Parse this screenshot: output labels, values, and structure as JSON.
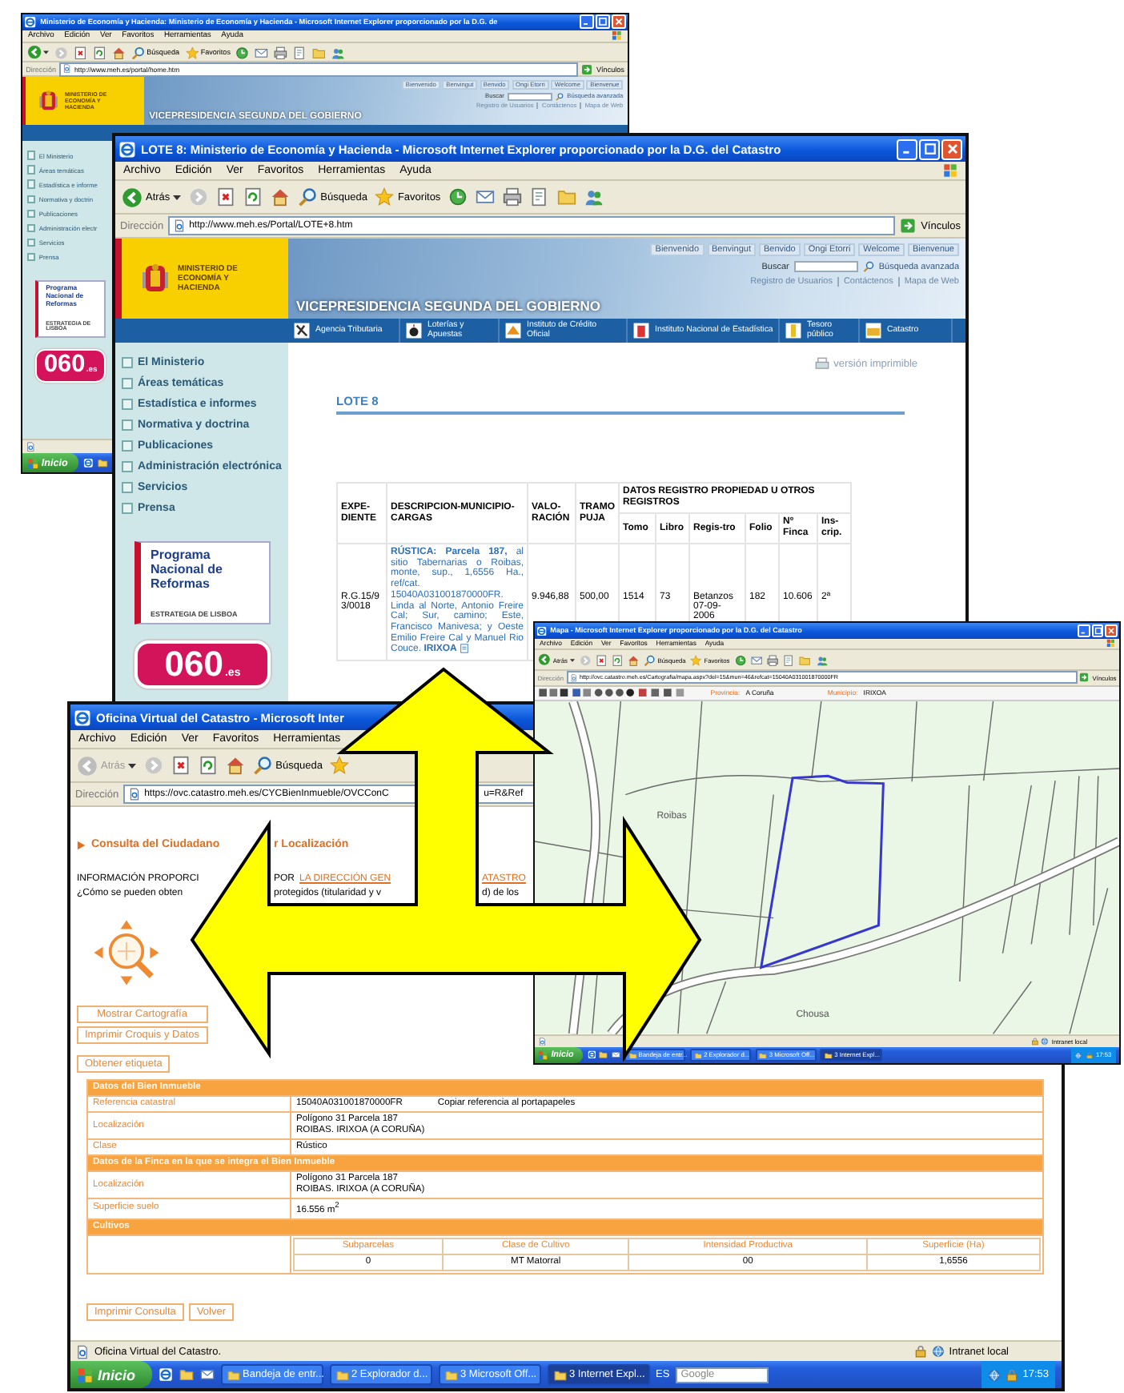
{
  "windows": [
    {
      "kind": "ministry",
      "title": "Ministerio de Economía y Hacienda: Ministerio de Economía y Hacienda - Microsoft Internet Explorer proporcionado por la D.G. de",
      "menu": [
        "Archivo",
        "Edición",
        "Ver",
        "Favoritos",
        "Herramientas",
        "Ayuda"
      ],
      "toolbar": {
        "back_disabled": false,
        "search": "Búsqueda",
        "favorites": "Favoritos"
      },
      "address_label": "Dirección",
      "address": [
        "http://www.meh.es/portal/home.htm"
      ],
      "links_label": "Vínculos",
      "page": {
        "ministry": "MINISTERIO DE ECONOMÍA Y HACIENDA",
        "languages": [
          "Bienvenido",
          "Benvingut",
          "Benvido",
          "Ongi Etorri",
          "Welcome",
          "Bienvenue"
        ],
        "search_label": "Buscar",
        "advanced_search": "Búsqueda avanzada",
        "user_links": [
          "Registro de Usuarios",
          "Contáctenos",
          "Mapa de Web"
        ],
        "banner": "VICEPRESIDENCIA SEGUNDA DEL GOBIERNO",
        "nav": [
          "El Ministerio",
          "Áreas temáticas",
          "Estadística e informe",
          "Normativa y doctrin",
          "Publicaciones",
          "Administración electr",
          "Servicios",
          "Prensa"
        ],
        "reform_logo": {
          "title": "Programa Nacional de Reformas",
          "subtitle": "ESTRATEGIA DE LISBOA"
        },
        "phone_logo": {
          "number": "060",
          "suffix": ".es"
        }
      },
      "taskbar": {
        "start": "Inicio"
      }
    },
    {
      "kind": "ministry",
      "title": "LOTE 8: Ministerio de Economía y Hacienda - Microsoft Internet Explorer proporcionado por la D.G. del Catastro",
      "menu": [
        "Archivo",
        "Edición",
        "Ver",
        "Favoritos",
        "Herramientas",
        "Ayuda"
      ],
      "toolbar": {
        "back": "Atrás",
        "back_disabled": false,
        "search": "Búsqueda",
        "favorites": "Favoritos"
      },
      "address_label": "Dirección",
      "address": [
        "http://www.meh.es/Portal/LOTE+8.htm"
      ],
      "links_label": "Vínculos",
      "page": {
        "ministry": "MINISTERIO DE ECONOMÍA Y HACIENDA",
        "languages": [
          "Bienvenido",
          "Benvingut",
          "Benvido",
          "Ongi Etorri",
          "Welcome",
          "Bienvenue"
        ],
        "search_label": "Buscar",
        "advanced_search": "Búsqueda avanzada",
        "user_links": [
          "Registro de Usuarios",
          "Contáctenos",
          "Mapa de Web"
        ],
        "banner": "VICEPRESIDENCIA SEGUNDA DEL GOBIERNO",
        "services": [
          "Agencia Tributaria",
          "Loterías y Apuestas",
          "Instituto de Crédito Oficial",
          "Instituto Nacional de Estadística",
          "Tesoro público",
          "Catastro"
        ],
        "nav": [
          "El Ministerio",
          "Áreas temáticas",
          "Estadística e informes",
          "Normativa y doctrina",
          "Publicaciones",
          "Administración electrónica",
          "Servicios",
          "Prensa"
        ],
        "reform_logo": {
          "title": "Programa Nacional de Reformas",
          "subtitle": "ESTRATEGIA DE LISBOA"
        },
        "phone_logo": {
          "number": "060",
          "suffix": ".es"
        },
        "print_link": "versión imprimible",
        "lot_title": "LOTE 8",
        "table": {
          "columns": [
            "EXPE-DIENTE",
            "DESCRIPCION-MUNICIPIO-CARGAS",
            "VALO-RACIÓN",
            "TRAMO PUJA"
          ],
          "column_groups": [
            {
              "label": "DATOS REGISTRO PROPIEDAD U OTROS REGISTROS",
              "columns": [
                "Tomo",
                "Libro",
                "Regis-tro",
                "Folio",
                "Nº Finca",
                "Ins-crip."
              ]
            }
          ],
          "rows": [
            [
              "R.G.15/93/0018",
              "**RÚSTICA: Parcela 187,** al sitio Tabernarias o Roibas, monte, sup., 1,6556 Ha., ref/cat. 15040A031001870000FR. Linda al Norte, Antonio Freire Cal; Sur, camino; Este, Francisco Manivesa; y Oeste Emilio Freire Cal y Manuel Rio Couce. **IRIXOA**",
              "9.946,88",
              "500,00",
              "1514",
              "73",
              "Betanzos 07-09-2006",
              "182",
              "10.606",
              "2ª"
            ]
          ]
        }
      }
    },
    {
      "kind": "catastro",
      "title": "Oficina Virtual del Catastro - Microsoft Inter",
      "menu": [
        "Archivo",
        "Edición",
        "Ver",
        "Favoritos",
        "Herramientas"
      ],
      "toolbar": {
        "back": "Atrás",
        "back_disabled": true,
        "search": "Búsqueda"
      },
      "address_label": "Dirección",
      "address": [
        "https://ovc.catastro.meh.es/CYCBienInmueble/OVCConC",
        "u=R&Ref"
      ],
      "page": {
        "heading": [
          "Consulta del Ciudadano",
          "r Localización"
        ],
        "notice": [
          {
            "kind": "text",
            "text": "INFORMACIÓN PROPORCI"
          },
          {
            "kind": "text",
            "text": "POR"
          },
          {
            "kind": "link",
            "text": "LA DIRECCIÓN GEN"
          },
          {
            "kind": "link",
            "text": "ATASTRO"
          }
        ],
        "question": [
          "¿Cómo se pueden obten",
          "protegidos (titularidad y v",
          "d) de los"
        ],
        "buttons": [
          "Mostrar Cartografía",
          "Imprimir Croquis y Datos"
        ],
        "label_button": "Obtener etiqueta",
        "sections": [
          {
            "title": "Datos del Bien Inmueble",
            "rows": [
              {
                "label": "Referencia catastral",
                "value": [
                  "15040A031001870000FR"
                ],
                "action": "Copiar referencia al portapapeles"
              },
              {
                "label": "Localización",
                "value": [
                  "Polígono 31 Parcela 187",
                  "ROIBAS. IRIXOA (A CORUÑA)"
                ]
              },
              {
                "label": "Clase",
                "value": [
                  "Rústico"
                ]
              }
            ]
          },
          {
            "title": "Datos de la Finca en la que se integra el Bien Inmueble",
            "rows": [
              {
                "label": "Localización",
                "value": [
                  "Polígono 31 Parcela 187",
                  "ROIBAS. IRIXOA (A CORUÑA)"
                ]
              },
              {
                "label": "Superficie suelo",
                "value": [
                  "16.556 m$^{2}$"
                ]
              }
            ]
          },
          {
            "title": "Cultivos",
            "crops": {
              "columns": [
                "Subparcelas",
                "Clase de Cultivo",
                "Intensidad Productiva",
                "Superficie (Ha)"
              ],
              "rows": [
                [
                  "0",
                  "MT Matorral",
                  "00",
                  "1,6556"
                ]
              ]
            }
          }
        ],
        "footer_buttons": [
          "Imprimir Consulta",
          "Volver"
        ]
      },
      "status": {
        "text": "Oficina Virtual del Catastro.",
        "zone": "Intranet local"
      },
      "taskbar": {
        "start": "Inicio",
        "tasks": [
          {
            "label": "Bandeja de entr...",
            "selected": false
          },
          {
            "label": "2 Explorador d...",
            "selected": false
          },
          {
            "label": "3 Microsoft Off...",
            "selected": false
          },
          {
            "label": "3 Internet Expl...",
            "selected": true
          }
        ],
        "language": "ES",
        "search_placeholder": "Google",
        "clock": "17:53"
      }
    },
    {
      "kind": "map",
      "title": "Mapa - Microsoft Internet Explorer proporcionado por la D.G. del Catastro",
      "menu": [
        "Archivo",
        "Edición",
        "Ver",
        "Favoritos",
        "Herramientas",
        "Ayuda"
      ],
      "toolbar": {
        "back": "Atrás",
        "back_disabled": false,
        "search": "Búsqueda",
        "favorites": "Favoritos"
      },
      "address_label": "Dirección",
      "address": [
        "http://ovc.catastro.meh.es/Cartografia/mapa.aspx?del=15&mun=46&refcat=15040A031001870000FR"
      ],
      "links_label": "Vínculos",
      "page": {
        "province_label": "Provincia:",
        "province": "A Coruña",
        "municipality_label": "Municipio:",
        "municipality": "IRIXOA",
        "places": [
          "Roibas",
          "Chousa"
        ]
      },
      "status": {
        "zone": "Intranet local"
      },
      "taskbar": {
        "start": "Inicio",
        "tasks": [
          {
            "label": "Bandeja de entr...",
            "selected": false
          },
          {
            "label": "2 Explorador d...",
            "selected": false
          },
          {
            "label": "3 Microsoft Off...",
            "selected": false
          },
          {
            "label": "3 Internet Expl...",
            "selected": true
          }
        ],
        "clock": "17:53"
      }
    }
  ]
}
